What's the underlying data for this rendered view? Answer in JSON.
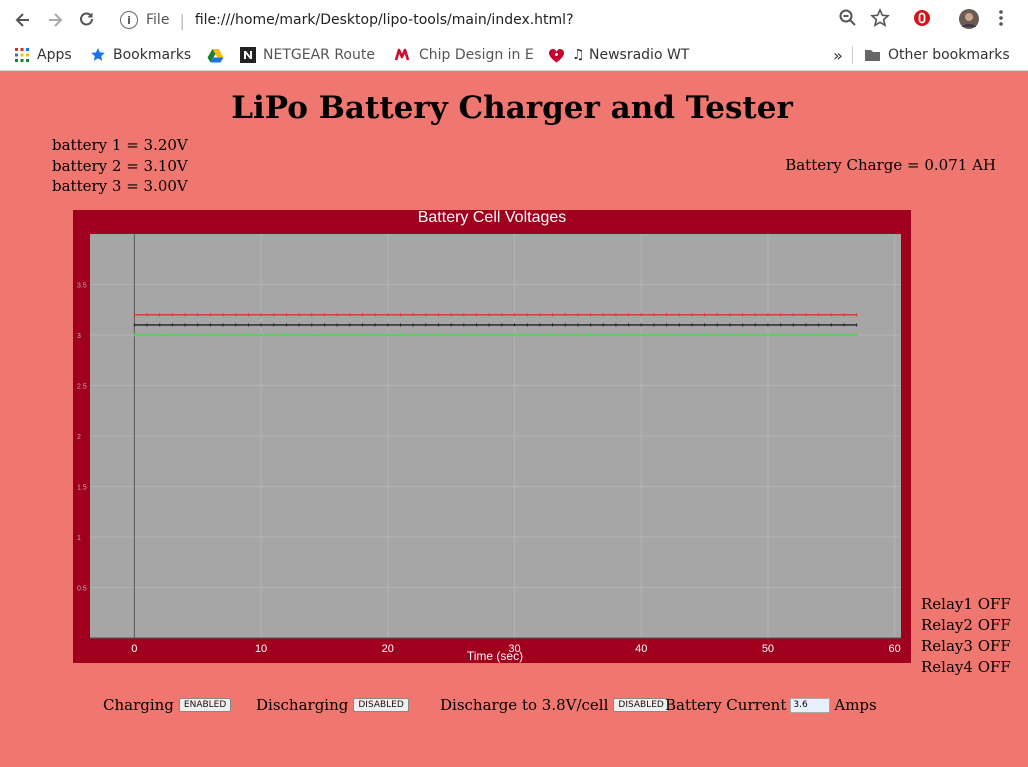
{
  "browser": {
    "scheme_label": "File",
    "url": "file:///home/mark/Desktop/lipo-tools/main/index.html?",
    "bookmarks": [
      {
        "label": "Apps",
        "icon": "apps-grid-icon"
      },
      {
        "label": "Bookmarks",
        "icon": "star-icon"
      },
      {
        "label": "",
        "icon": "drive-icon"
      },
      {
        "label": "NETGEAR Route",
        "icon": "netgear-icon"
      },
      {
        "label": "Chip Design in E",
        "icon": "m-logo-icon"
      },
      {
        "label": "♫ Newsradio WT",
        "icon": "iheart-icon"
      }
    ],
    "overflow_label": "»",
    "other_bookmarks": "Other bookmarks"
  },
  "page": {
    "title": "LiPo Battery Charger and Tester",
    "voltages": [
      "battery 1 = 3.20V",
      "battery 2 = 3.10V",
      "battery 3 = 3.00V"
    ],
    "charge": "Battery Charge = 0.071 AH",
    "relays": [
      "Relay1 OFF",
      "Relay2 OFF",
      "Relay3 OFF",
      "Relay4 OFF"
    ],
    "controls": {
      "charging_label": "Charging",
      "charging_state": "ENABLED",
      "discharging_label": "Discharging",
      "discharging_state": "DISABLED",
      "discharge_to_label": "Discharge to 3.8V/cell",
      "discharge_to_state": "DISABLED",
      "current_label": "Battery Current",
      "current_value": "3.6",
      "current_unit": "Amps"
    }
  },
  "chart_data": {
    "type": "line",
    "title": "Battery Cell Voltages",
    "xlabel": "Time (sec)",
    "ylabel": "",
    "xlim": [
      -3.5,
      60.5
    ],
    "ylim": [
      0,
      4
    ],
    "xticks": [
      "0",
      "10",
      "20",
      "30",
      "40",
      "50",
      "60"
    ],
    "yticks": [
      "0.5",
      "1",
      "1.5",
      "2",
      "2.5",
      "3",
      "3.5"
    ],
    "grid": true,
    "series": [
      {
        "color": "#e0312d",
        "x_start": 0,
        "x_end": 57,
        "value": 3.2
      },
      {
        "color": "#222222",
        "x_start": 0,
        "x_end": 57,
        "value": 3.1
      },
      {
        "color": "#3ee03e",
        "x_start": 0,
        "x_end": 57,
        "value": 3.0
      }
    ]
  }
}
